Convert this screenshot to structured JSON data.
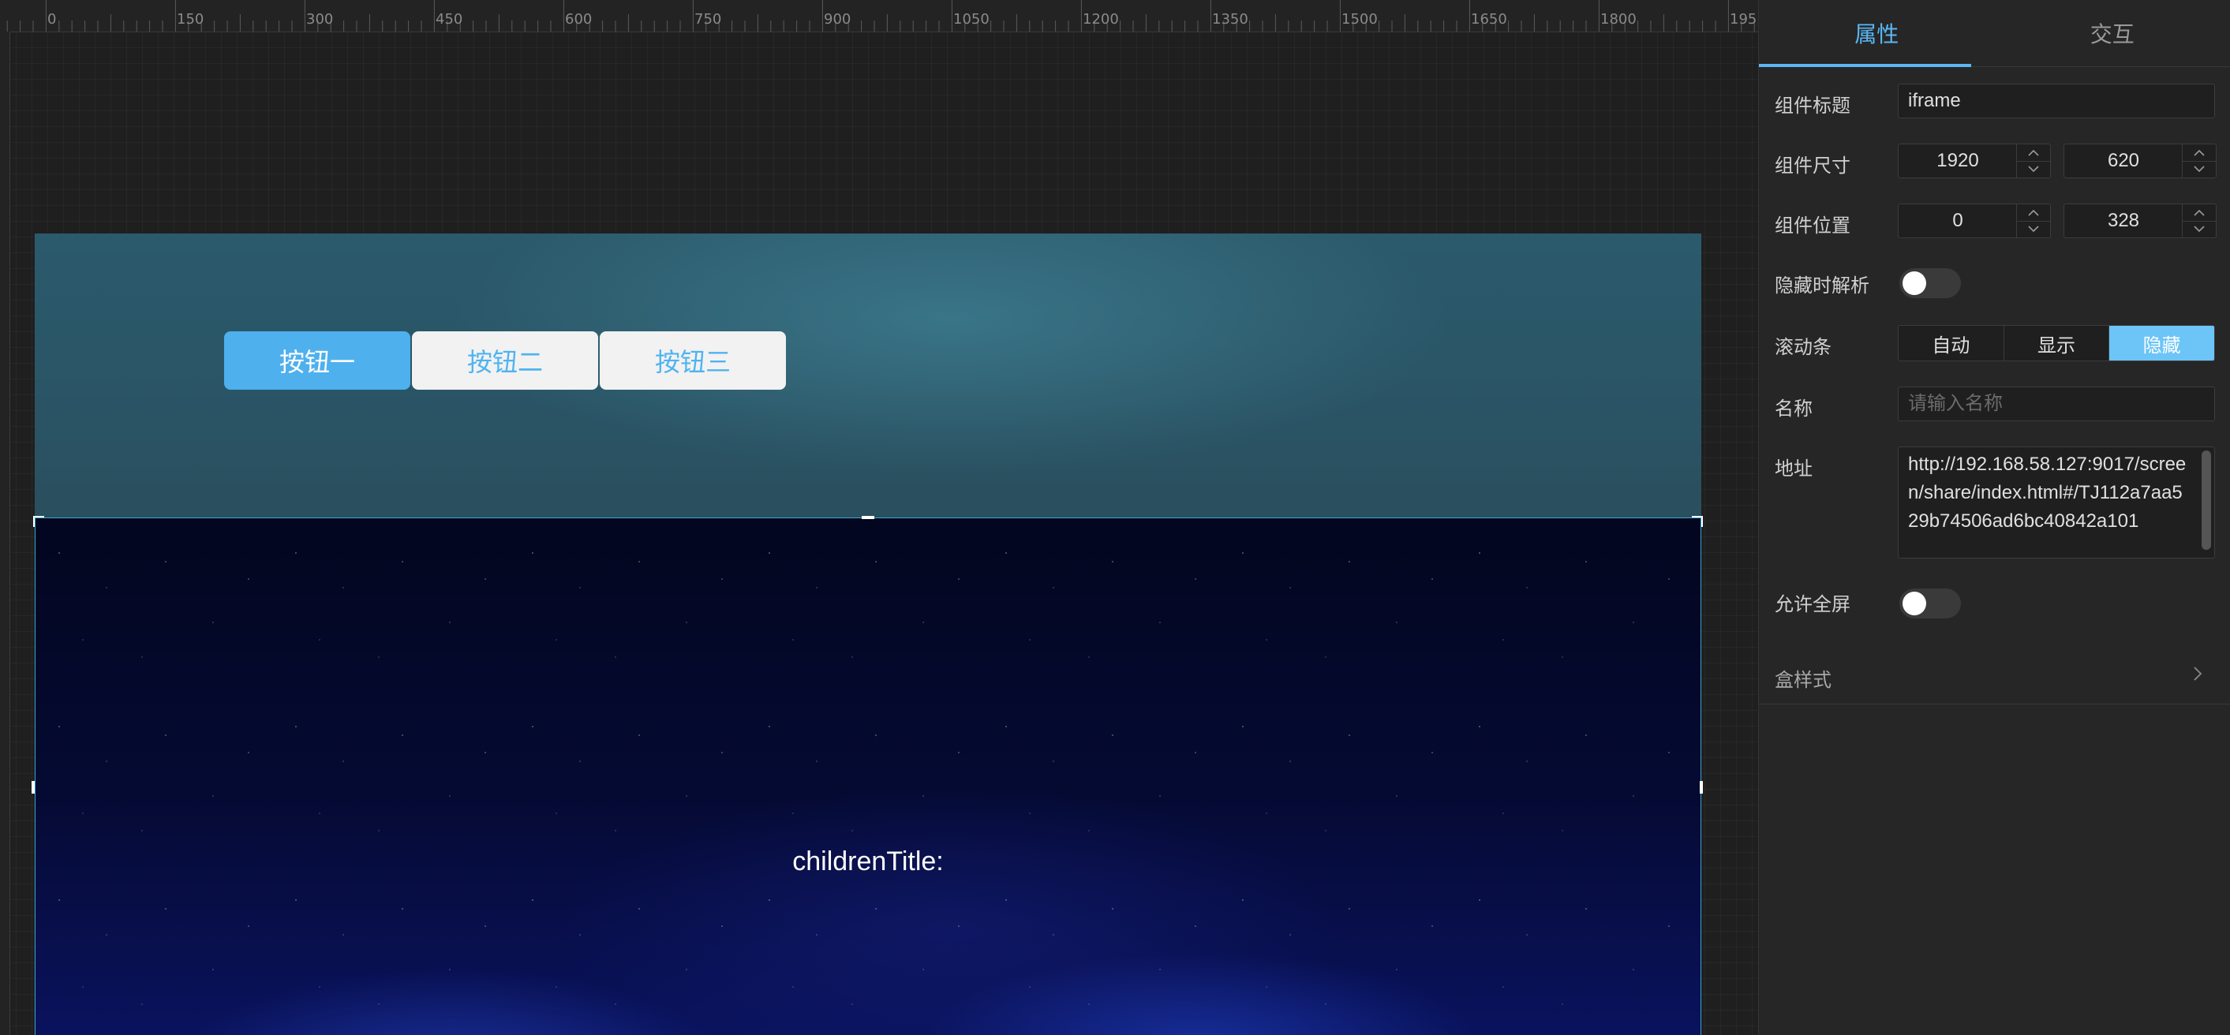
{
  "ruler": {
    "ticks": [
      "0",
      "150",
      "300",
      "450",
      "600",
      "750",
      "900",
      "1050",
      "1200",
      "1350",
      "1500",
      "1650",
      "1800",
      "195"
    ]
  },
  "canvas": {
    "buttons": [
      {
        "label": "按钮一",
        "active": true
      },
      {
        "label": "按钮二",
        "active": false
      },
      {
        "label": "按钮三",
        "active": false
      }
    ],
    "iframe_title": "childrenTitle:"
  },
  "panel": {
    "tabs": [
      {
        "label": "属性",
        "active": true
      },
      {
        "label": "交互",
        "active": false
      }
    ],
    "component_title_label": "组件标题",
    "component_title_value": "iframe",
    "size_label": "组件尺寸",
    "width": "1920",
    "height": "620",
    "position_label": "组件位置",
    "pos_x": "0",
    "pos_y": "328",
    "hidden_parse_label": "隐藏时解析",
    "hidden_parse_on": false,
    "scrollbar_label": "滚动条",
    "scrollbar_options": [
      "自动",
      "显示",
      "隐藏"
    ],
    "scrollbar_selected": "隐藏",
    "name_label": "名称",
    "name_placeholder": "请输入名称",
    "address_label": "地址",
    "address_value": "http://192.168.58.127:9017/screen/share/index.html#/TJ112a7aa529b74506ad6bc40842a101",
    "fullscreen_label": "允许全屏",
    "fullscreen_on": false,
    "box_style_label": "盒样式"
  },
  "colors": {
    "accent": "#59b8f5",
    "button_active": "#4fb0ee",
    "segment_active": "#6cc4f7"
  }
}
